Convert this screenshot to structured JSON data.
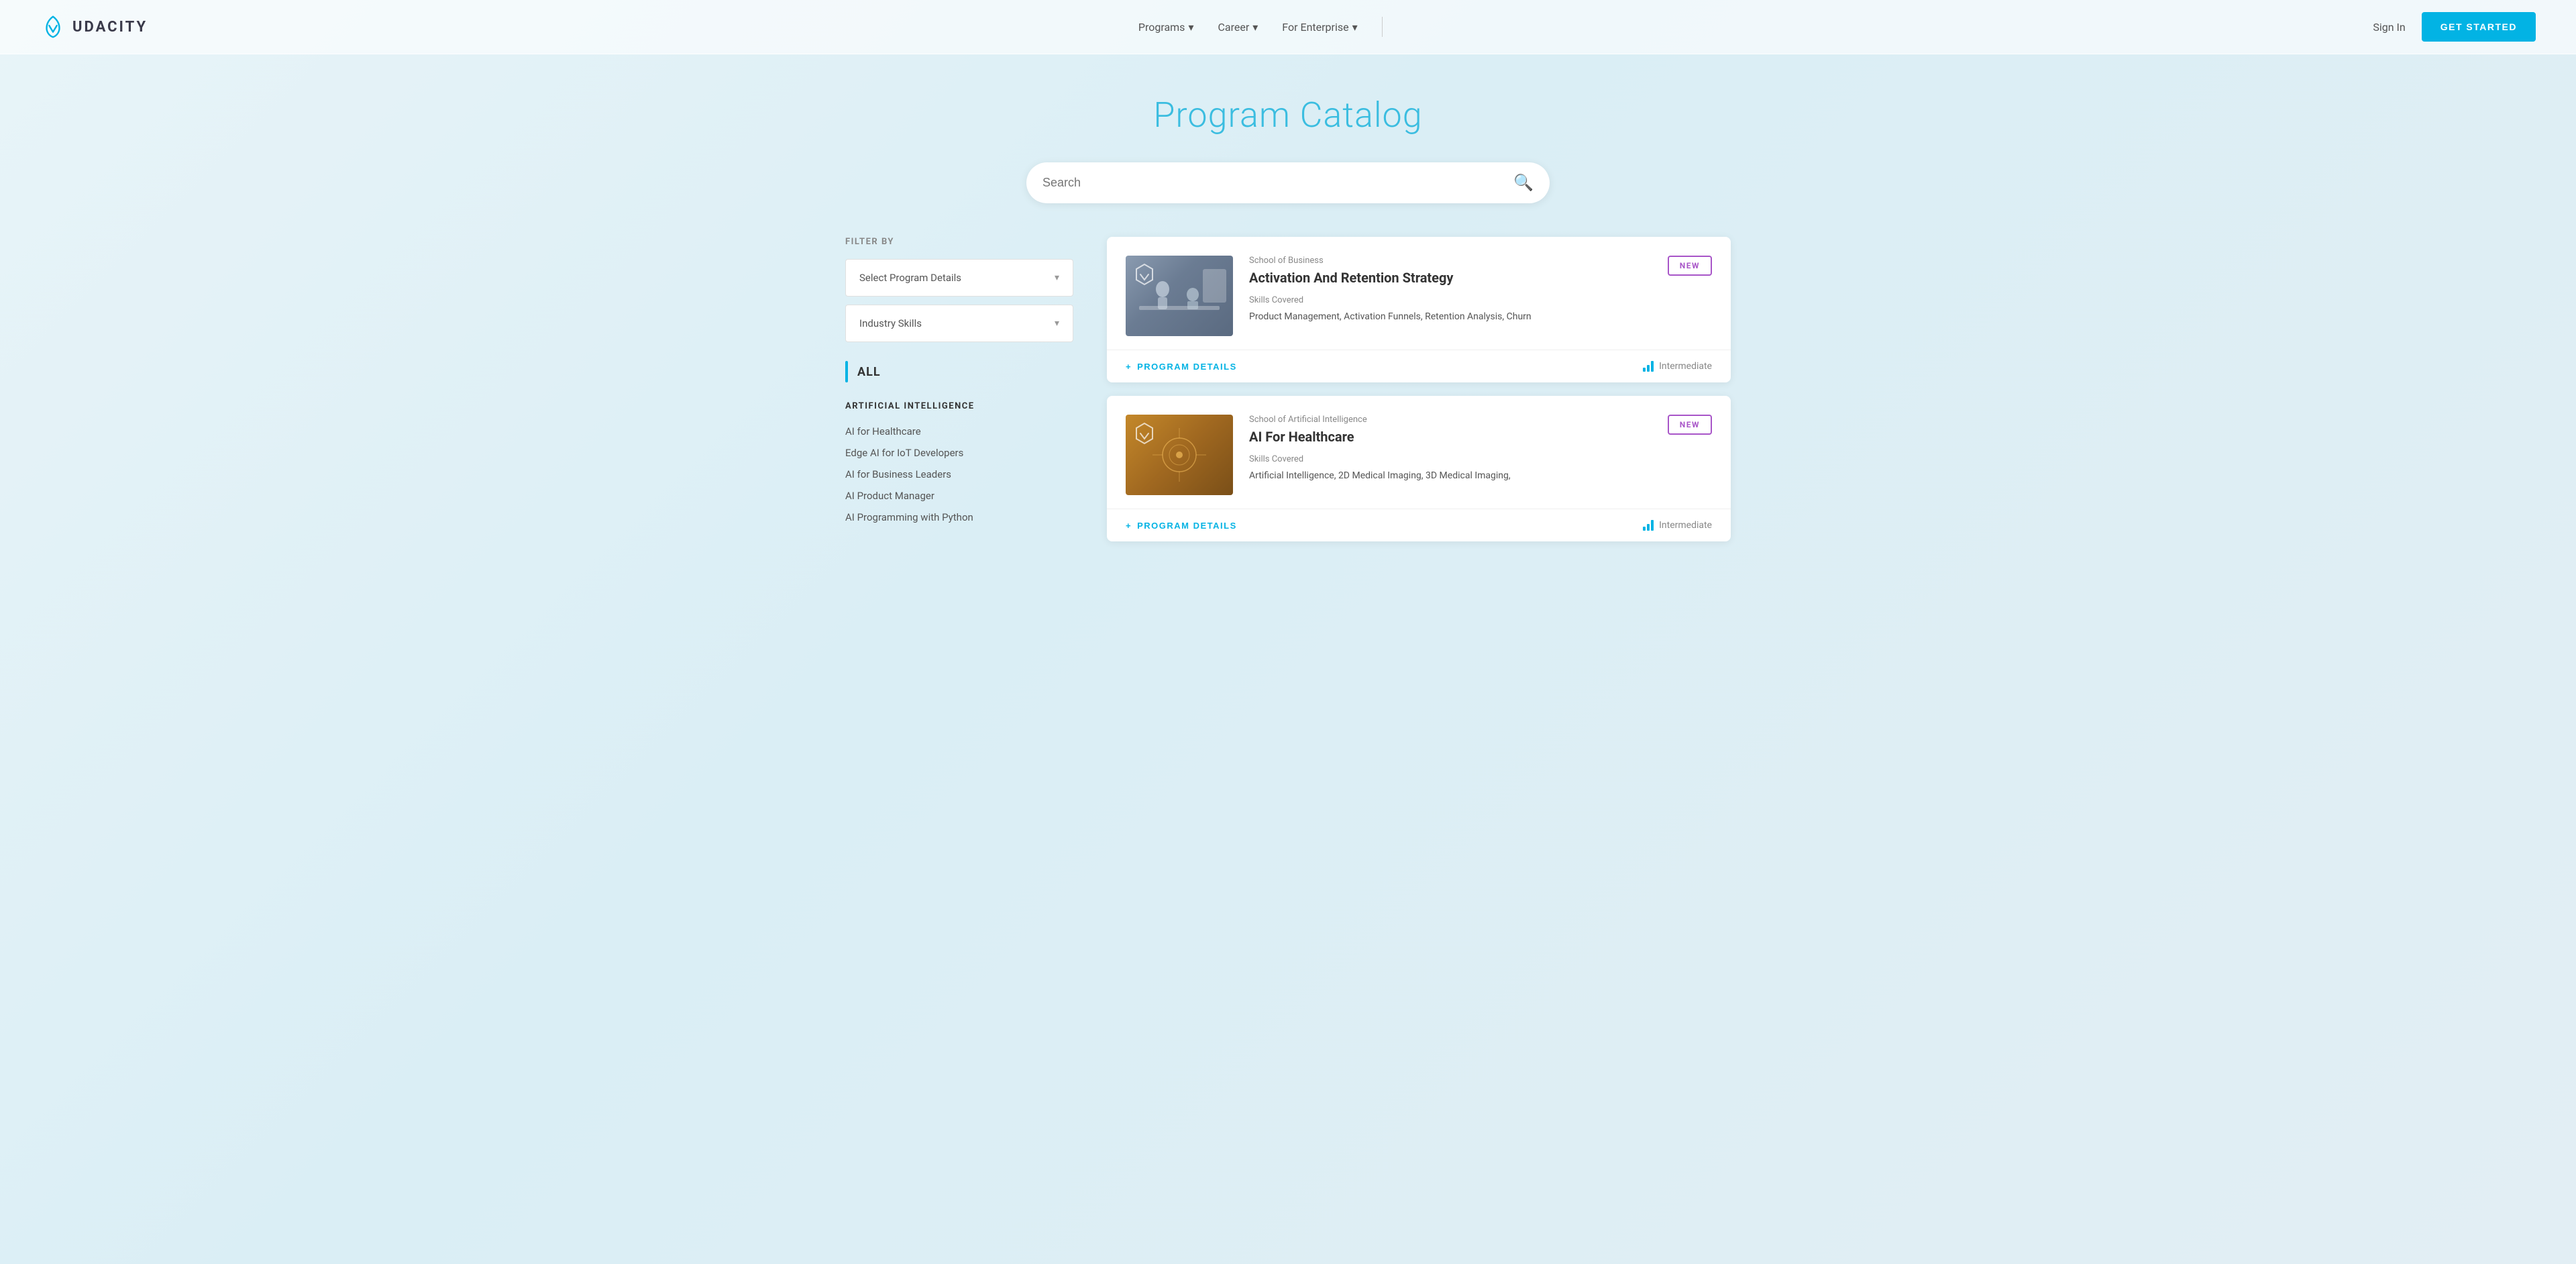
{
  "nav": {
    "logo_text": "UDACITY",
    "links": [
      {
        "label": "Programs",
        "has_dropdown": true
      },
      {
        "label": "Career",
        "has_dropdown": true
      },
      {
        "label": "For Enterprise",
        "has_dropdown": true
      }
    ],
    "sign_in": "Sign In",
    "get_started": "GET STARTED"
  },
  "hero": {
    "title": "Program Catalog"
  },
  "search": {
    "placeholder": "Search"
  },
  "sidebar": {
    "filter_by_label": "FILTER BY",
    "dropdown1": {
      "placeholder": "Select Program Details"
    },
    "dropdown2": {
      "placeholder": "Industry Skills"
    },
    "all_label": "ALL",
    "category": {
      "title": "ARTIFICIAL INTELLIGENCE",
      "items": [
        "AI for Healthcare",
        "Edge AI for IoT Developers",
        "AI for Business Leaders",
        "AI Product Manager",
        "AI Programming with Python"
      ]
    }
  },
  "cards": [
    {
      "school": "School of Business",
      "title": "Activation And Retention Strategy",
      "is_new": true,
      "new_label": "NEW",
      "skills_label": "Skills Covered",
      "skills": "Product Management, Activation Funnels, Retention Analysis, Churn",
      "level": "Intermediate",
      "program_details_label": "PROGRAM DETAILS",
      "thumb_type": "business"
    },
    {
      "school": "School of Artificial Intelligence",
      "title": "AI For Healthcare",
      "is_new": true,
      "new_label": "NEW",
      "skills_label": "Skills Covered",
      "skills": "Artificial Intelligence, 2D Medical Imaging, 3D Medical Imaging,",
      "level": "Intermediate",
      "program_details_label": "PROGRAM DETAILS",
      "thumb_type": "ai"
    }
  ]
}
